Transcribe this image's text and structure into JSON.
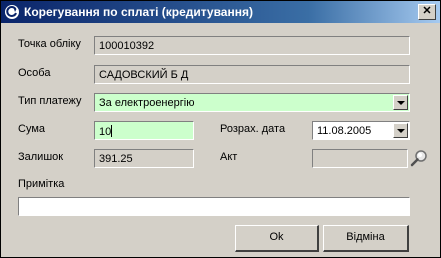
{
  "window": {
    "title": "Корегування по сплаті (кредитування)",
    "close_label": "✕"
  },
  "form": {
    "accounting_point": {
      "label": "Точка обліку",
      "value": "100010392"
    },
    "person": {
      "label": "Особа",
      "value": "САДОВСКИЙ Б Д"
    },
    "payment_type": {
      "label": "Тип платежу",
      "value": "За електроенергію"
    },
    "amount": {
      "label": "Сума",
      "value": "10"
    },
    "calc_date": {
      "label": "Розрах. дата",
      "value": "11.08.2005"
    },
    "balance": {
      "label": "Залишок",
      "value": "391.25"
    },
    "act": {
      "label": "Акт",
      "value": ""
    },
    "note": {
      "label": "Примітка",
      "value": ""
    }
  },
  "buttons": {
    "ok": "Ok",
    "cancel": "Відміна"
  },
  "colors": {
    "title_start": "#0a246a",
    "title_end": "#a6caf0",
    "required_field": "#ccffcc",
    "face": "#d4d0c8"
  },
  "icons": {
    "title": "app-refresh-icon",
    "search": "search-icon"
  }
}
